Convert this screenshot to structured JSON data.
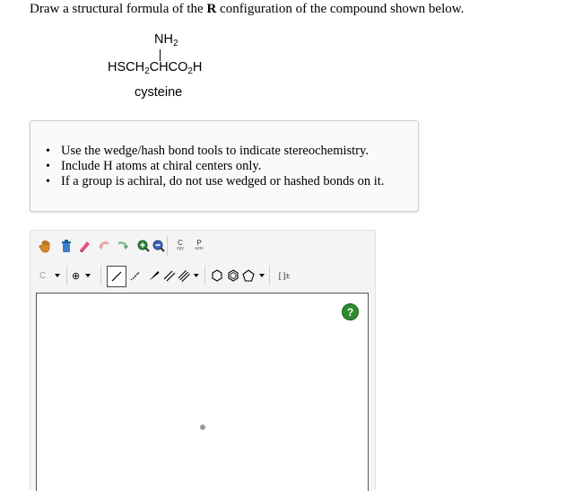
{
  "question": {
    "prefix": "Draw a structural formula of the ",
    "bold": "R",
    "suffix": " configuration of the compound shown below."
  },
  "compound": {
    "amino_group": "NH",
    "amino_sub": "2",
    "main_formula": [
      {
        "text": "HSCH"
      },
      {
        "sub": "2"
      },
      {
        "text": "CHCO"
      },
      {
        "sub": "2"
      },
      {
        "text": "H"
      }
    ],
    "name": "cysteine"
  },
  "instructions": [
    "Use the wedge/hash bond tools to indicate stereochemistry.",
    "Include H atoms at chiral centers only.",
    "If a group is achiral, do not use wedged or hashed bonds on it."
  ],
  "toolbar": {
    "row1": [
      {
        "name": "hand-icon"
      },
      {
        "name": "erase-icon"
      },
      {
        "name": "eraser-icon"
      },
      {
        "name": "undo-icon"
      },
      {
        "name": "redo-icon"
      },
      {
        "name": "zoom-in-icon"
      },
      {
        "name": "zoom-out-icon"
      },
      {
        "name": "copy-icon",
        "label": "C",
        "sub": "opy"
      },
      {
        "name": "paste-icon",
        "label": "P",
        "sub": "aste"
      }
    ],
    "row2": [
      {
        "name": "atom-select",
        "label": "C"
      },
      {
        "name": "charge-plus-icon",
        "label": "⊕"
      },
      {
        "name": "single-bond-icon"
      },
      {
        "name": "hash-bond-icon"
      },
      {
        "name": "wedge-bond-icon"
      },
      {
        "name": "double-bond-icon"
      },
      {
        "name": "triple-bond-icon"
      },
      {
        "name": "benzene-icon"
      },
      {
        "name": "cyclohexane-icon"
      },
      {
        "name": "pentagon-icon"
      },
      {
        "name": "bracket-icon",
        "label": "[ ]±"
      }
    ]
  },
  "help_label": "?"
}
